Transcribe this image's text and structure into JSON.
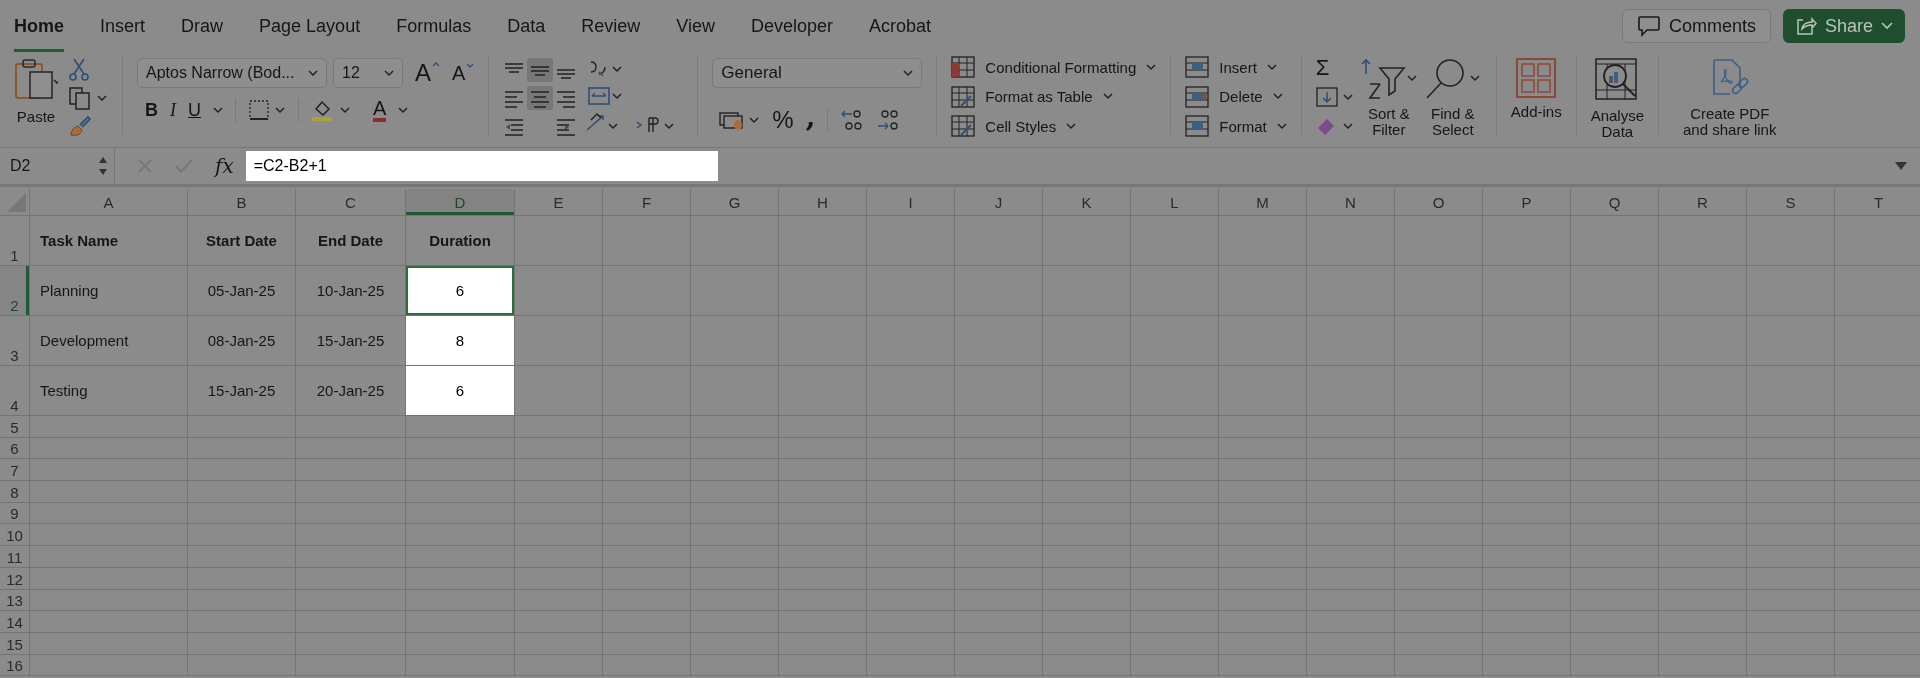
{
  "ribbon_tabs": [
    {
      "label": "Home",
      "selected": true
    },
    {
      "label": "Insert",
      "selected": false
    },
    {
      "label": "Draw",
      "selected": false
    },
    {
      "label": "Page Layout",
      "selected": false
    },
    {
      "label": "Formulas",
      "selected": false
    },
    {
      "label": "Data",
      "selected": false
    },
    {
      "label": "Review",
      "selected": false
    },
    {
      "label": "View",
      "selected": false
    },
    {
      "label": "Developer",
      "selected": false
    },
    {
      "label": "Acrobat",
      "selected": false
    }
  ],
  "header_buttons": {
    "comments": "Comments",
    "share": "Share"
  },
  "ribbon": {
    "paste": "Paste",
    "font_name": "Aptos Narrow (Bod...",
    "font_size": "12",
    "grow_font": "A",
    "shrink_font": "A",
    "bold": "B",
    "italic": "I",
    "underline": "U",
    "font_color": "A",
    "number_format": "General",
    "percent": "%",
    "comma": ",",
    "styles": [
      "Conditional Formatting",
      "Format as Table",
      "Cell Styles"
    ],
    "cells": [
      "Insert",
      "Delete",
      "Format"
    ],
    "autosum": "Σ",
    "sort_filter": [
      "Sort &",
      "Filter"
    ],
    "find_select": [
      "Find &",
      "Select"
    ],
    "add_ins": "Add-ins",
    "analyse_data": [
      "Analyse",
      "Data"
    ],
    "create_pdf": [
      "Create PDF",
      "and share link"
    ]
  },
  "formula_bar": {
    "name_box": "D2",
    "fx": "fx",
    "formula": "=C2-B2+1"
  },
  "sheet": {
    "columns": [
      {
        "label": "A",
        "selected": false
      },
      {
        "label": "B",
        "selected": false
      },
      {
        "label": "C",
        "selected": false
      },
      {
        "label": "D",
        "selected": true
      },
      {
        "label": "E",
        "selected": false
      },
      {
        "label": "F",
        "selected": false
      },
      {
        "label": "G",
        "selected": false
      },
      {
        "label": "H",
        "selected": false
      },
      {
        "label": "I",
        "selected": false
      },
      {
        "label": "J",
        "selected": false
      },
      {
        "label": "K",
        "selected": false
      },
      {
        "label": "L",
        "selected": false
      },
      {
        "label": "M",
        "selected": false
      },
      {
        "label": "N",
        "selected": false
      },
      {
        "label": "O",
        "selected": false
      },
      {
        "label": "P",
        "selected": false
      },
      {
        "label": "Q",
        "selected": false
      },
      {
        "label": "R",
        "selected": false
      },
      {
        "label": "S",
        "selected": false
      },
      {
        "label": "T",
        "selected": false
      }
    ],
    "rows": [
      {
        "label": "1",
        "kind": "header",
        "selected": false,
        "cells": [
          {
            "text": "Task Name",
            "highlighted": false,
            "selected": false
          },
          {
            "text": "Start Date",
            "highlighted": false,
            "selected": false
          },
          {
            "text": "End Date",
            "highlighted": false,
            "selected": false
          },
          {
            "text": "Duration",
            "highlighted": false,
            "selected": false
          }
        ]
      },
      {
        "label": "2",
        "kind": "data",
        "selected": true,
        "cells": [
          {
            "text": "Planning",
            "highlighted": false,
            "selected": false
          },
          {
            "text": "05-Jan-25",
            "highlighted": false,
            "selected": false
          },
          {
            "text": "10-Jan-25",
            "highlighted": false,
            "selected": false
          },
          {
            "text": "6",
            "highlighted": true,
            "selected": true
          }
        ]
      },
      {
        "label": "3",
        "kind": "data",
        "selected": false,
        "cells": [
          {
            "text": "Development",
            "highlighted": false,
            "selected": false
          },
          {
            "text": "08-Jan-25",
            "highlighted": false,
            "selected": false
          },
          {
            "text": "15-Jan-25",
            "highlighted": false,
            "selected": false
          },
          {
            "text": "8",
            "highlighted": true,
            "selected": false
          }
        ]
      },
      {
        "label": "4",
        "kind": "data",
        "selected": false,
        "cells": [
          {
            "text": "Testing",
            "highlighted": false,
            "selected": false
          },
          {
            "text": "15-Jan-25",
            "highlighted": false,
            "selected": false
          },
          {
            "text": "20-Jan-25",
            "highlighted": false,
            "selected": false
          },
          {
            "text": "6",
            "highlighted": true,
            "selected": false
          }
        ]
      },
      {
        "label": "5",
        "kind": "empty",
        "selected": false,
        "cells": []
      },
      {
        "label": "6",
        "kind": "empty",
        "selected": false,
        "cells": []
      },
      {
        "label": "7",
        "kind": "empty",
        "selected": false,
        "cells": []
      },
      {
        "label": "8",
        "kind": "empty",
        "selected": false,
        "cells": []
      },
      {
        "label": "9",
        "kind": "empty",
        "selected": false,
        "cells": []
      },
      {
        "label": "10",
        "kind": "empty",
        "selected": false,
        "cells": []
      },
      {
        "label": "11",
        "kind": "empty",
        "selected": false,
        "cells": []
      },
      {
        "label": "12",
        "kind": "empty",
        "selected": false,
        "cells": []
      },
      {
        "label": "13",
        "kind": "empty",
        "selected": false,
        "cells": []
      },
      {
        "label": "14",
        "kind": "empty",
        "selected": false,
        "cells": []
      },
      {
        "label": "15",
        "kind": "empty",
        "selected": false,
        "cells": []
      },
      {
        "label": "16",
        "kind": "empty",
        "selected": false,
        "cells": []
      }
    ]
  }
}
